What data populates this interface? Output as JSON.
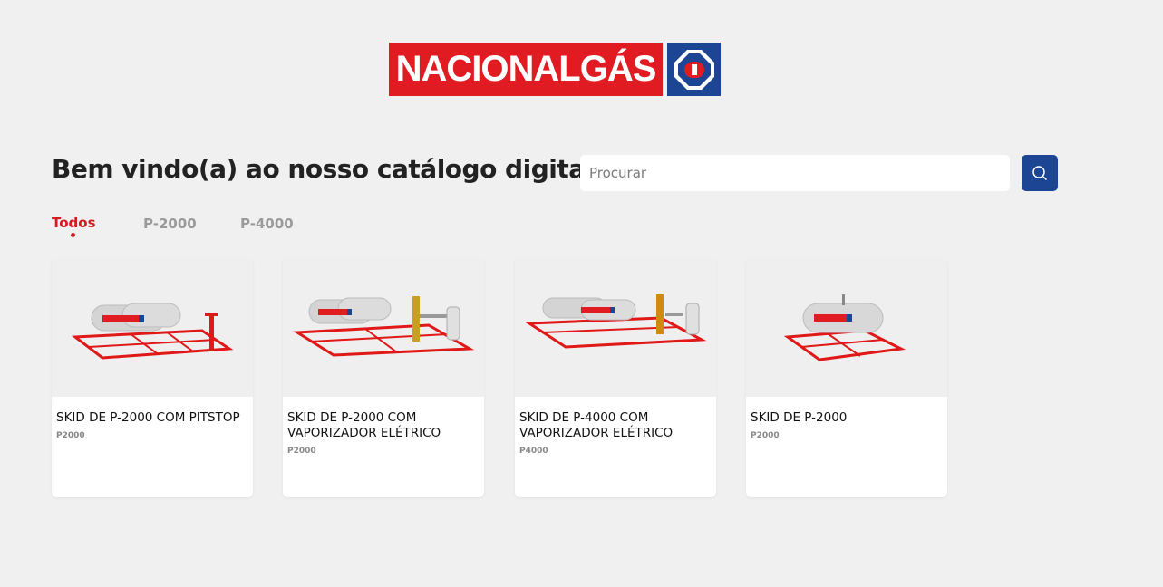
{
  "brand": {
    "name": "NACIONALGÁS",
    "red": "#e11b22",
    "blue": "#1c4594"
  },
  "header": {
    "title": "Bem vindo(a) ao nosso catálogo digital"
  },
  "search": {
    "placeholder": "Procurar",
    "icon": "search-icon"
  },
  "tabs": [
    {
      "label": "Todos",
      "active": true
    },
    {
      "label": "P-2000",
      "active": false
    },
    {
      "label": "P-4000",
      "active": false
    }
  ],
  "products": [
    {
      "name": "SKID DE P-2000 COM PITSTOP",
      "code": "P2000"
    },
    {
      "name": "SKID DE P-2000 COM VAPORIZADOR ELÉTRICO",
      "code": "P2000"
    },
    {
      "name": "SKID DE P-4000 COM VAPORIZADOR ELÉTRICO",
      "code": "P4000"
    },
    {
      "name": "SKID DE P-2000",
      "code": "P2000"
    }
  ]
}
